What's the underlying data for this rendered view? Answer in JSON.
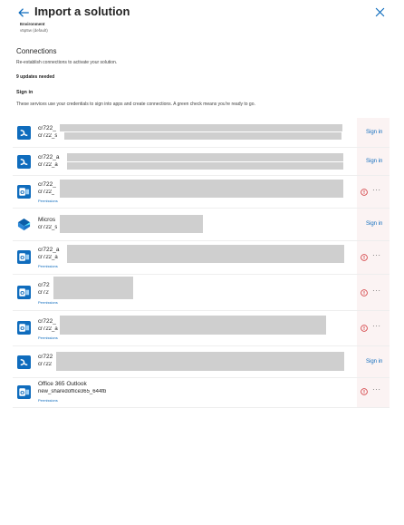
{
  "header": {
    "title": "Import a solution"
  },
  "environment": {
    "label": "Environment",
    "value": "v5p5w (default)"
  },
  "connections": {
    "heading": "Connections",
    "subtitle": "Re-establish connections to activate your solution.",
    "updates_needed": "9 updates needed"
  },
  "signin": {
    "heading": "Sign in",
    "description": "These services use your credentials to sign into apps and create connections. A green check means you're ready to go."
  },
  "rows": [
    {
      "icon": "dataverse-icon",
      "title": "cr722_",
      "subtitle": "cr722_s",
      "action": "Sign in",
      "permissions": ""
    },
    {
      "icon": "dataverse-icon",
      "title": "cr722_a",
      "subtitle": "cr722_a",
      "action": "Sign in",
      "permissions": ""
    },
    {
      "icon": "outlook-icon",
      "title": "cr722_",
      "subtitle": "cr722_",
      "action": "",
      "permissions": "Permissions"
    },
    {
      "icon": "sharepoint-icon",
      "title": "Micros",
      "subtitle": "cr722_s",
      "action": "Sign in",
      "permissions": ""
    },
    {
      "icon": "outlook-icon",
      "title": "cr722_a",
      "subtitle": "cr722_a",
      "action": "",
      "permissions": "Permissions"
    },
    {
      "icon": "outlook-icon",
      "title": "cr72",
      "subtitle": "cr72",
      "action": "",
      "permissions": "Permissions"
    },
    {
      "icon": "outlook-icon",
      "title": "cr722_",
      "subtitle": "cr722_a",
      "action": "",
      "permissions": "Permissions"
    },
    {
      "icon": "dataverse-icon",
      "title": "cr722",
      "subtitle": "cr722",
      "action": "Sign in",
      "permissions": ""
    },
    {
      "icon": "outlook-icon",
      "title": "Office 365 Outlook",
      "subtitle": "new_sharedoffice365_644fb",
      "action": "",
      "permissions": "Permissions"
    }
  ],
  "colors": {
    "accent": "#0f6cbd",
    "warning": "#d13438",
    "redacted": "#cfcfcf"
  }
}
